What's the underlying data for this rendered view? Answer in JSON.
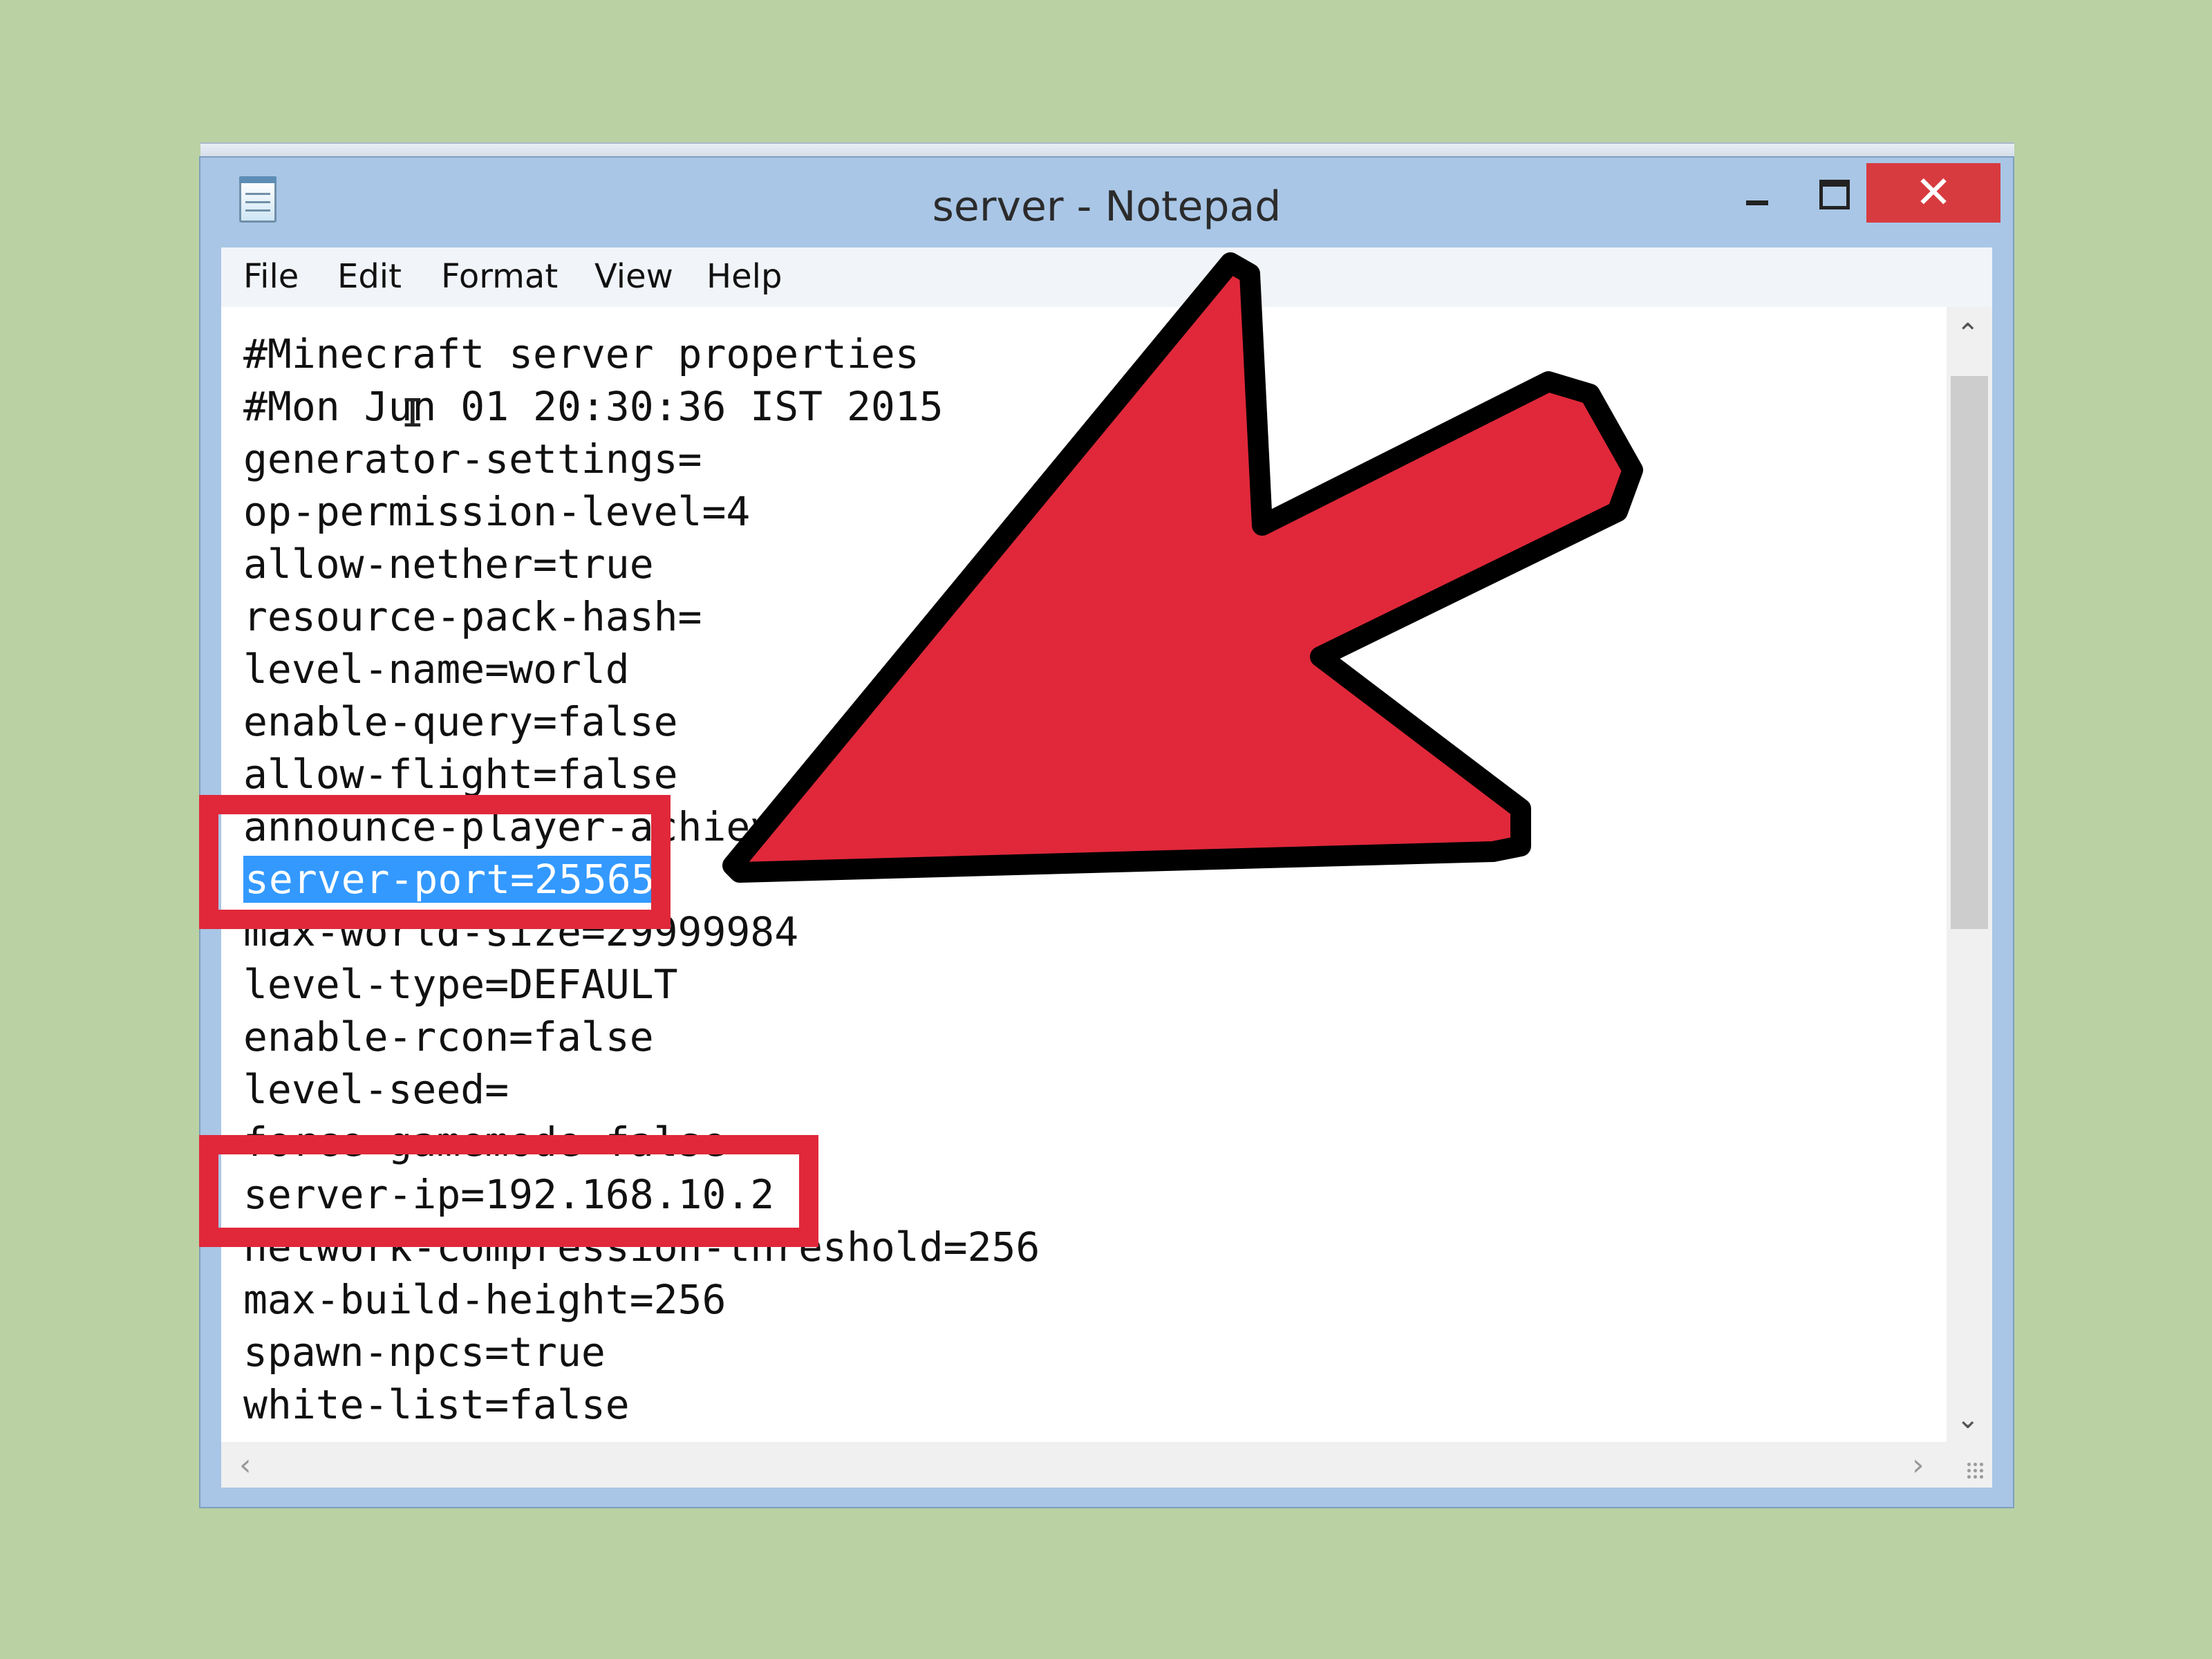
{
  "window": {
    "title": "server - Notepad",
    "close_symbol": "✕"
  },
  "menu": [
    "File",
    "Edit",
    "Format",
    "View",
    "Help"
  ],
  "editor": {
    "lines": [
      "#Minecraft server properties",
      "#Mon Jun 01 20:30:36 IST 2015",
      "generator-settings=",
      "op-permission-level=4",
      "allow-nether=true",
      "resource-pack-hash=",
      "level-name=world",
      "enable-query=false",
      "allow-flight=false",
      "announce-player-achiev",
      "server-port=25565",
      "max-world-size=29999984",
      "level-type=DEFAULT",
      "enable-rcon=false",
      "level-seed=",
      "force-gamemode=false",
      "server-ip=192.168.10.2",
      "network-compression-threshold=256",
      "max-build-height=256",
      "spawn-npcs=true",
      "white-list=false"
    ],
    "selected_line": "server-port=25565"
  },
  "annotations": {
    "highlight_color": "#e0283a",
    "arrow_color": "#e0283a",
    "highlighted": [
      "server-port=25565",
      "server-ip=192.168.10.2"
    ]
  },
  "icons": [
    "notepad-icon",
    "minimize-icon",
    "maximize-icon",
    "close-icon",
    "scroll-up-icon",
    "scroll-down-icon",
    "scroll-left-icon",
    "scroll-right-icon",
    "resize-grip-icon",
    "pointer-arrow-icon"
  ]
}
